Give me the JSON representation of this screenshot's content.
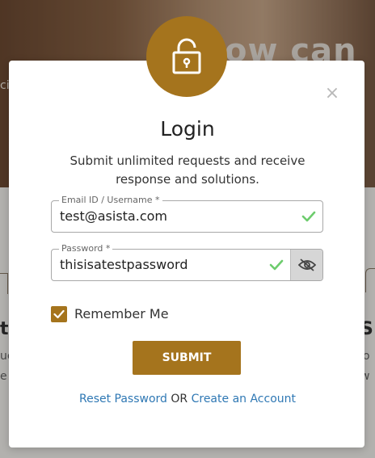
{
  "background": {
    "hero_text": "ow can w",
    "hero_small": "ci",
    "left_heading": "t",
    "left_line1": "ue",
    "left_line2": "e",
    "right_heading": "S",
    "right_line1": "o",
    "right_line2": "w"
  },
  "modal": {
    "lock_icon": "unlock-icon",
    "close_label": "×",
    "title": "Login",
    "subtitle": "Submit unlimited requests and receive response and solutions.",
    "email": {
      "label": "Email ID / Username *",
      "value": "test@asista.com",
      "valid": true
    },
    "password": {
      "label": "Password *",
      "value": "thisisatestpassword",
      "valid": true,
      "toggle_icon": "eye-slash-icon"
    },
    "remember": {
      "label": "Remember Me",
      "checked": true
    },
    "submit_label": "SUBMIT",
    "links": {
      "reset": "Reset Password",
      "separator": "OR",
      "create": "Create an Account"
    }
  },
  "colors": {
    "accent": "#a5741d",
    "valid_check": "#6dcc6d",
    "link": "#2f78b4"
  }
}
